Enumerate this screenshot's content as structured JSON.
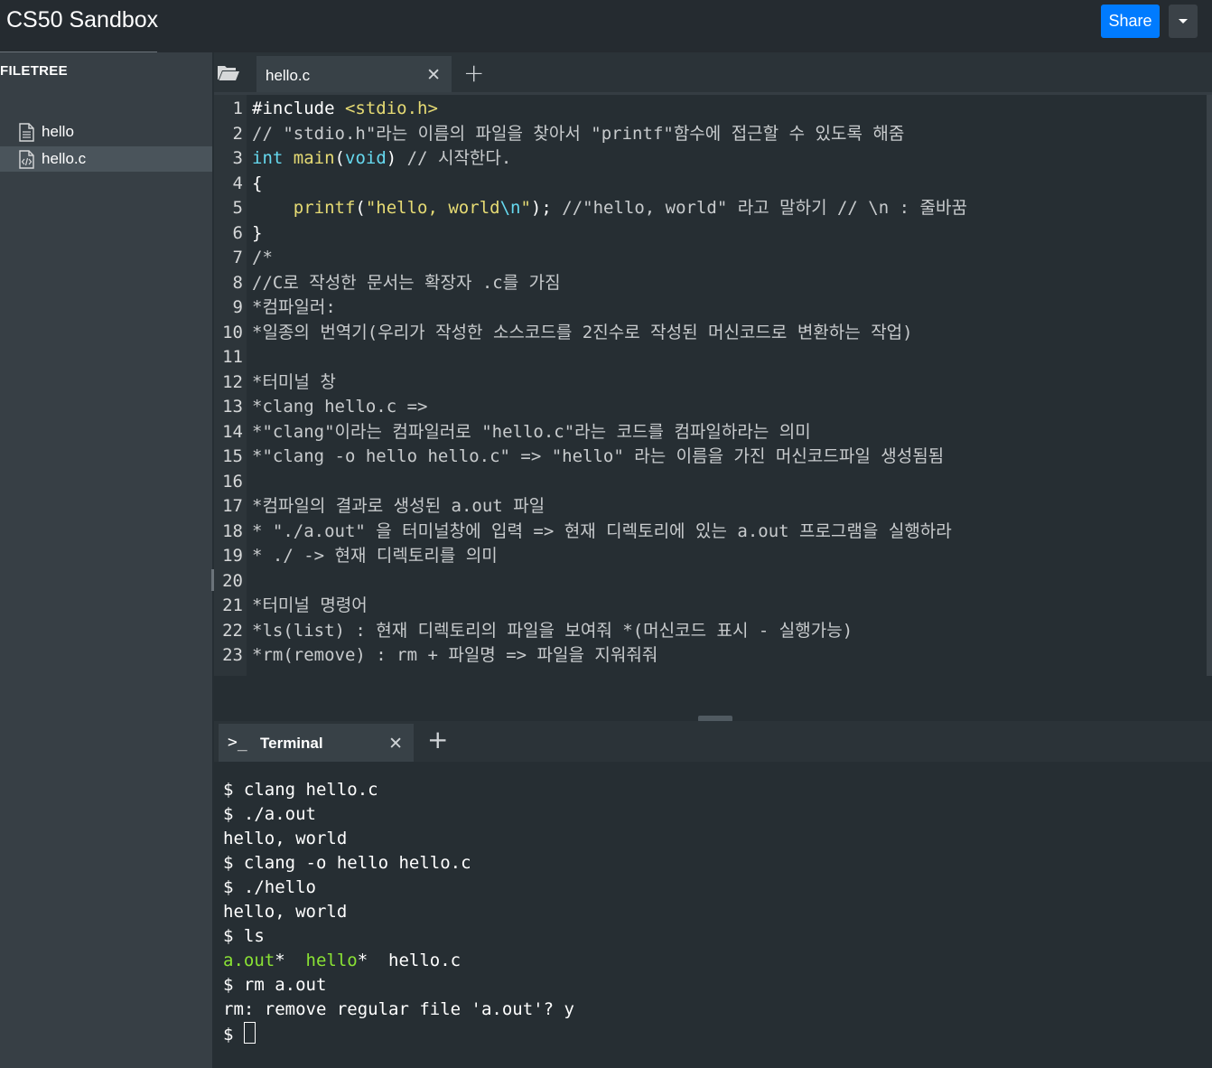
{
  "app": {
    "title": "CS50 Sandbox",
    "share_label": "Share"
  },
  "colors": {
    "share": "#007bff",
    "keyword": "#66d9ef",
    "string": "#e6db74",
    "terminal_exec": "#8ae234"
  },
  "sidebar": {
    "title": "FILETREE",
    "items": [
      {
        "label": "hello",
        "icon": "file-icon",
        "selected": false
      },
      {
        "label": "hello.c",
        "icon": "code-file-icon",
        "selected": true
      }
    ]
  },
  "editor": {
    "tab_label": "hello.c",
    "lines": [
      {
        "n": "1",
        "segs": [
          {
            "t": "#include ",
            "c": "pre"
          },
          {
            "t": "<stdio.h>",
            "c": "str"
          }
        ]
      },
      {
        "n": "2",
        "segs": [
          {
            "t": "// \"stdio.h\"라는 이름의 파일을 찾아서 \"printf\"함수에 접근할 수 있도록 해줌",
            "c": "cm"
          }
        ]
      },
      {
        "n": "3",
        "segs": [
          {
            "t": "int",
            "c": "kw"
          },
          {
            "t": " ",
            "c": "wt"
          },
          {
            "t": "main",
            "c": "fn"
          },
          {
            "t": "(",
            "c": "wt"
          },
          {
            "t": "void",
            "c": "kw"
          },
          {
            "t": ") ",
            "c": "wt"
          },
          {
            "t": "// 시작한다.",
            "c": "cm"
          }
        ]
      },
      {
        "n": "4",
        "segs": [
          {
            "t": "{",
            "c": "wt"
          }
        ]
      },
      {
        "n": "5",
        "segs": [
          {
            "t": "    ",
            "c": "wt"
          },
          {
            "t": "printf",
            "c": "fn"
          },
          {
            "t": "(",
            "c": "wt"
          },
          {
            "t": "\"hello, world",
            "c": "str"
          },
          {
            "t": "\\n",
            "c": "esc"
          },
          {
            "t": "\"",
            "c": "str"
          },
          {
            "t": "); ",
            "c": "wt"
          },
          {
            "t": "//\"hello, world\" 라고 말하기 // \\n : 줄바꿈",
            "c": "cm"
          }
        ]
      },
      {
        "n": "6",
        "segs": [
          {
            "t": "}",
            "c": "wt"
          }
        ]
      },
      {
        "n": "7",
        "segs": [
          {
            "t": "/*",
            "c": "cm"
          }
        ]
      },
      {
        "n": "8",
        "segs": [
          {
            "t": "//C로 작성한 문서는 확장자 .c를 가짐",
            "c": "cm"
          }
        ]
      },
      {
        "n": "9",
        "segs": [
          {
            "t": "*컴파일러:",
            "c": "cm"
          }
        ]
      },
      {
        "n": "10",
        "segs": [
          {
            "t": "*일종의 번역기(우리가 작성한 소스코드를 2진수로 작성된 머신코드로 변환하는 작업)",
            "c": "cm"
          }
        ]
      },
      {
        "n": "11",
        "segs": [
          {
            "t": "",
            "c": "cm"
          }
        ]
      },
      {
        "n": "12",
        "segs": [
          {
            "t": "*터미널 창",
            "c": "cm"
          }
        ]
      },
      {
        "n": "13",
        "segs": [
          {
            "t": "*clang hello.c =>",
            "c": "cm"
          }
        ]
      },
      {
        "n": "14",
        "segs": [
          {
            "t": "*\"clang\"이라는 컴파일러로 \"hello.c\"라는 코드를 컴파일하라는 의미",
            "c": "cm"
          }
        ]
      },
      {
        "n": "15",
        "segs": [
          {
            "t": "*\"clang -o hello hello.c\" => \"hello\" 라는 이름을 가진 머신코드파일 생성됨됨",
            "c": "cm"
          }
        ]
      },
      {
        "n": "16",
        "segs": [
          {
            "t": "",
            "c": "cm"
          }
        ]
      },
      {
        "n": "17",
        "segs": [
          {
            "t": "*컴파일의 결과로 생성된 a.out 파일",
            "c": "cm"
          }
        ]
      },
      {
        "n": "18",
        "segs": [
          {
            "t": "* \"./a.out\" 을 터미널창에 입력 => 현재 디렉토리에 있는 a.out 프로그램을 실행하라",
            "c": "cm"
          }
        ]
      },
      {
        "n": "19",
        "segs": [
          {
            "t": "* ./ -> 현재 디렉토리를 의미",
            "c": "cm"
          }
        ]
      },
      {
        "n": "20",
        "segs": [
          {
            "t": "",
            "c": "cm"
          }
        ]
      },
      {
        "n": "21",
        "segs": [
          {
            "t": "*터미널 명령어",
            "c": "cm"
          }
        ]
      },
      {
        "n": "22",
        "segs": [
          {
            "t": "*ls(list) : 현재 디렉토리의 파일을 보여줘 *(머신코드 표시 - 실행가능)",
            "c": "cm"
          }
        ]
      },
      {
        "n": "23",
        "segs": [
          {
            "t": "*rm(remove) : rm + 파일명 => 파일을 지워줘줘",
            "c": "cm"
          }
        ]
      }
    ]
  },
  "terminal": {
    "tab_icon": ">_",
    "tab_label": "Terminal",
    "lines": [
      [
        {
          "t": "$ clang hello.c",
          "c": "wt"
        }
      ],
      [
        {
          "t": "$ ./a.out",
          "c": "wt"
        }
      ],
      [
        {
          "t": "hello, world",
          "c": "wt"
        }
      ],
      [
        {
          "t": "$ clang -o hello hello.c",
          "c": "wt"
        }
      ],
      [
        {
          "t": "$ ./hello",
          "c": "wt"
        }
      ],
      [
        {
          "t": "hello, world",
          "c": "wt"
        }
      ],
      [
        {
          "t": "$ ls",
          "c": "wt"
        }
      ],
      [
        {
          "t": "a.out",
          "c": "green"
        },
        {
          "t": "*  ",
          "c": "wt"
        },
        {
          "t": "hello",
          "c": "green"
        },
        {
          "t": "*  hello.c",
          "c": "wt"
        }
      ],
      [
        {
          "t": "$ rm a.out",
          "c": "wt"
        }
      ],
      [
        {
          "t": "rm: remove regular file 'a.out'? y",
          "c": "wt"
        }
      ],
      [
        {
          "t": "$ ",
          "c": "wt"
        }
      ]
    ]
  }
}
